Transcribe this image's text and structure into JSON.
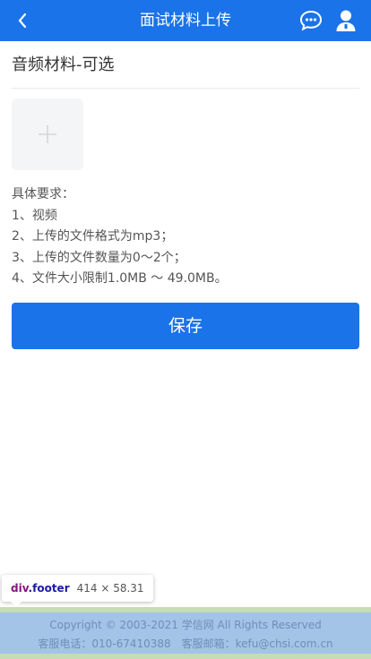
{
  "header": {
    "title": "面试材料上传",
    "back_icon": "chevron-left-icon",
    "chat_icon": "chat-bubble-icon",
    "user_icon": "user-icon"
  },
  "section": {
    "title": "音频材料-可选"
  },
  "upload": {
    "icon": "plus-icon"
  },
  "requirements": {
    "heading": "具体要求：",
    "items": [
      "1、视频",
      "2、上传的文件格式为mp3；",
      "3、上传的文件数量为0～2个；",
      "4、文件大小限制1.0MB ～ 49.0MB。"
    ]
  },
  "actions": {
    "save_label": "保存"
  },
  "devtools_tooltip": {
    "tag": "div",
    "class_name": ".footer",
    "size": "414 × 58.31"
  },
  "footer": {
    "copyright": "Copyright © 2003-2021 学信网 All Rights Reserved",
    "contact": "客服电话：010-67410388　客服邮箱：kefu@chsi.com.cn"
  },
  "colors": {
    "primary": "#1a73e8",
    "footer_bg": "#a3c4e6",
    "footer_text": "#6d8fb8"
  }
}
